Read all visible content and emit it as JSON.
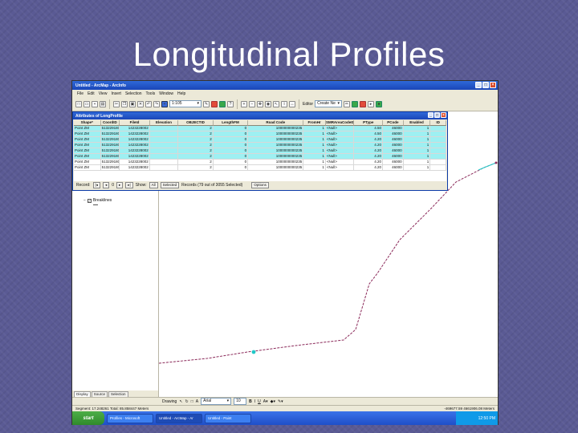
{
  "slide": {
    "title": "Longitudinal Profiles"
  },
  "window": {
    "title": "Untitled - ArcMap - ArcInfo"
  },
  "menu": [
    "File",
    "Edit",
    "View",
    "Insert",
    "Selection",
    "Tools",
    "Window",
    "Help"
  ],
  "toolbar": {
    "scale": "1:105",
    "editor_label": "Editor",
    "task": "Create Ne"
  },
  "toc": {
    "layer_name": "Breaklines",
    "tabs": [
      "Display",
      "Source",
      "Selection"
    ]
  },
  "attr_table": {
    "title": "Attributes of LongProfile",
    "columns": [
      "Shape*",
      "CoordID",
      "FileId",
      "Elevation",
      "OBJECTID",
      "LengthFM",
      "Road Code",
      "FromHr",
      "SMRAreaCodeID",
      "PType",
      "PCode",
      "Enabled",
      "ID"
    ],
    "rows": [
      {
        "cells": [
          "Point ZM",
          "513229180",
          "1423228002",
          "",
          "2",
          "0",
          "1000000000235",
          "1",
          "<Null>",
          "4.50",
          "46000",
          "1",
          ""
        ],
        "selected": true
      },
      {
        "cells": [
          "Point ZM",
          "513229180",
          "1423228002",
          "",
          "2",
          "0",
          "1000000000235",
          "1",
          "<Null>",
          "4.50",
          "46000",
          "1",
          ""
        ],
        "selected": true
      },
      {
        "cells": [
          "Point ZM",
          "513229180",
          "1423228002",
          "",
          "2",
          "0",
          "1000000000235",
          "1",
          "<Null>",
          "4.20",
          "46000",
          "1",
          ""
        ],
        "selected": true
      },
      {
        "cells": [
          "Point ZM",
          "513229180",
          "1423228002",
          "",
          "2",
          "0",
          "1000000000235",
          "1",
          "<Null>",
          "4.20",
          "46000",
          "1",
          ""
        ],
        "selected": true
      },
      {
        "cells": [
          "Point ZM",
          "513229180",
          "1423228002",
          "",
          "2",
          "0",
          "1000000000235",
          "1",
          "<Null>",
          "4.20",
          "46000",
          "1",
          ""
        ],
        "selected": true
      },
      {
        "cells": [
          "Point ZM",
          "513229180",
          "1423228002",
          "",
          "2",
          "0",
          "1000000000235",
          "1",
          "<Null>",
          "4.20",
          "46000",
          "1",
          ""
        ],
        "selected": true
      },
      {
        "cells": [
          "Point ZM",
          "513229180",
          "1423228002",
          "",
          "2",
          "0",
          "1000000000235",
          "1",
          "<Null>",
          "4.20",
          "46000",
          "1",
          ""
        ],
        "selected": false
      },
      {
        "cells": [
          "Point ZM",
          "513229180",
          "1423228002",
          "",
          "2",
          "0",
          "1000000000235",
          "1",
          "<Null>",
          "4.20",
          "46000",
          "1",
          ""
        ],
        "selected": false
      }
    ],
    "status": {
      "record_label": "Record:",
      "record_value": "0",
      "show_label": "Show:",
      "all_label": "All",
      "selected_label": "Selected",
      "records_text": "Records (79 out of 3055 Selected)",
      "options_label": "Options"
    }
  },
  "draw_toolbar": {
    "drawing_label": "Drawing",
    "font": "Arial",
    "size": "10"
  },
  "statusbar": {
    "left": "Segment: 17.248261  Total: 85.858447  Meters",
    "coords": "-469677.59  4661906.08 Meters"
  },
  "taskbar": {
    "start": "start",
    "tasks": [
      "Profiles - Microsoft",
      "Untitled - ArcMap - Ar",
      "Untitled - Paint"
    ],
    "clock": "12:50 PM"
  },
  "colors": {
    "accent": "#2f69d8",
    "selection": "#9ef0f2",
    "slide_bg": "#5a5a94",
    "profile_line": "#8b2a5a",
    "marker": "#20c8c8"
  },
  "icons": [
    "new-icon",
    "open-icon",
    "save-icon",
    "print-icon",
    "cut-icon",
    "copy-icon",
    "paste-icon",
    "delete-icon",
    "undo-icon",
    "redo-icon",
    "add-data-icon",
    "zoom-in-icon",
    "zoom-out-icon",
    "pan-icon",
    "identify-icon",
    "measure-icon"
  ]
}
